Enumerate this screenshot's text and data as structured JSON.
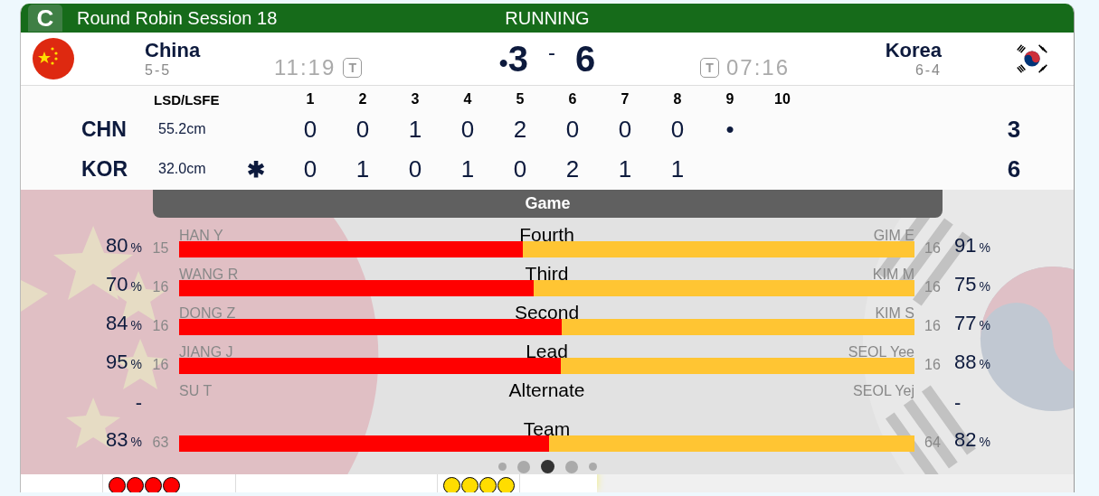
{
  "header": {
    "badge": "C",
    "title": "Round Robin Session 18",
    "status": "RUNNING"
  },
  "teams": [
    {
      "name": "China",
      "record": "5-5",
      "time": "11:19",
      "timeout": "T",
      "score_marker": "•",
      "score": "3"
    },
    {
      "name": "Korea",
      "record": "6-4",
      "time": "07:16",
      "timeout": "T",
      "score": "6"
    }
  ],
  "score_separator": "-",
  "linescore": {
    "lsd_heading": "LSD/LSFE",
    "ends": [
      "1",
      "2",
      "3",
      "4",
      "5",
      "6",
      "7",
      "8",
      "9",
      "10"
    ],
    "rows": [
      {
        "team": "CHN",
        "lsd": "55.2cm",
        "ends": [
          "0",
          "0",
          "1",
          "0",
          "2",
          "0",
          "0",
          "0",
          "•"
        ],
        "total": "3"
      },
      {
        "team": "KOR",
        "lsd": "32.0cm",
        "hammer": "✱",
        "ends": [
          "0",
          "1",
          "0",
          "1",
          "0",
          "2",
          "1",
          "1"
        ],
        "total": "6"
      }
    ]
  },
  "game": {
    "tab": "Game",
    "positions": [
      {
        "position": "Fourth",
        "level": 0.467,
        "left": {
          "name": "HAN Y",
          "shots": "15",
          "pct": "80",
          "unit": "%"
        },
        "right": {
          "name": "GIM E",
          "shots": "16",
          "pct": "91",
          "unit": "%"
        }
      },
      {
        "position": "Third",
        "level": 0.482,
        "left": {
          "name": "WANG R",
          "shots": "16",
          "pct": "70",
          "unit": "%"
        },
        "right": {
          "name": "KIM M",
          "shots": "16",
          "pct": "75",
          "unit": "%"
        }
      },
      {
        "position": "Second",
        "level": 0.52,
        "left": {
          "name": "DONG Z",
          "shots": "16",
          "pct": "84",
          "unit": "%"
        },
        "right": {
          "name": "KIM S",
          "shots": "16",
          "pct": "77",
          "unit": "%"
        }
      },
      {
        "position": "Lead",
        "level": 0.519,
        "left": {
          "name": "JIANG J",
          "shots": "16",
          "pct": "95",
          "unit": "%"
        },
        "right": {
          "name": "SEOL Yee",
          "shots": "16",
          "pct": "88",
          "unit": "%"
        }
      },
      {
        "position": "Alternate",
        "left": {
          "name": "SU T",
          "pct": "-"
        },
        "right": {
          "name": "SEOL Yej",
          "pct": "-"
        }
      },
      {
        "position": "Team",
        "level": 0.503,
        "left": {
          "shots": "63",
          "pct": "83",
          "unit": "%"
        },
        "right": {
          "shots": "64",
          "pct": "82",
          "unit": "%"
        }
      }
    ]
  },
  "pager": [
    {
      "selected": false
    },
    {
      "selected": false
    },
    {
      "selected": true
    },
    {
      "selected": false
    },
    {
      "selected": false
    }
  ],
  "stones": {
    "left": [
      {
        "color": "#ff0000"
      },
      {
        "color": "#ff0000"
      },
      {
        "color": "#ff0000"
      },
      {
        "color": "#ff0000"
      }
    ],
    "right": [
      {
        "color": "#ffdd00"
      },
      {
        "color": "#ffdd00"
      },
      {
        "color": "#ffdd00"
      },
      {
        "color": "#ffdd00"
      }
    ]
  }
}
